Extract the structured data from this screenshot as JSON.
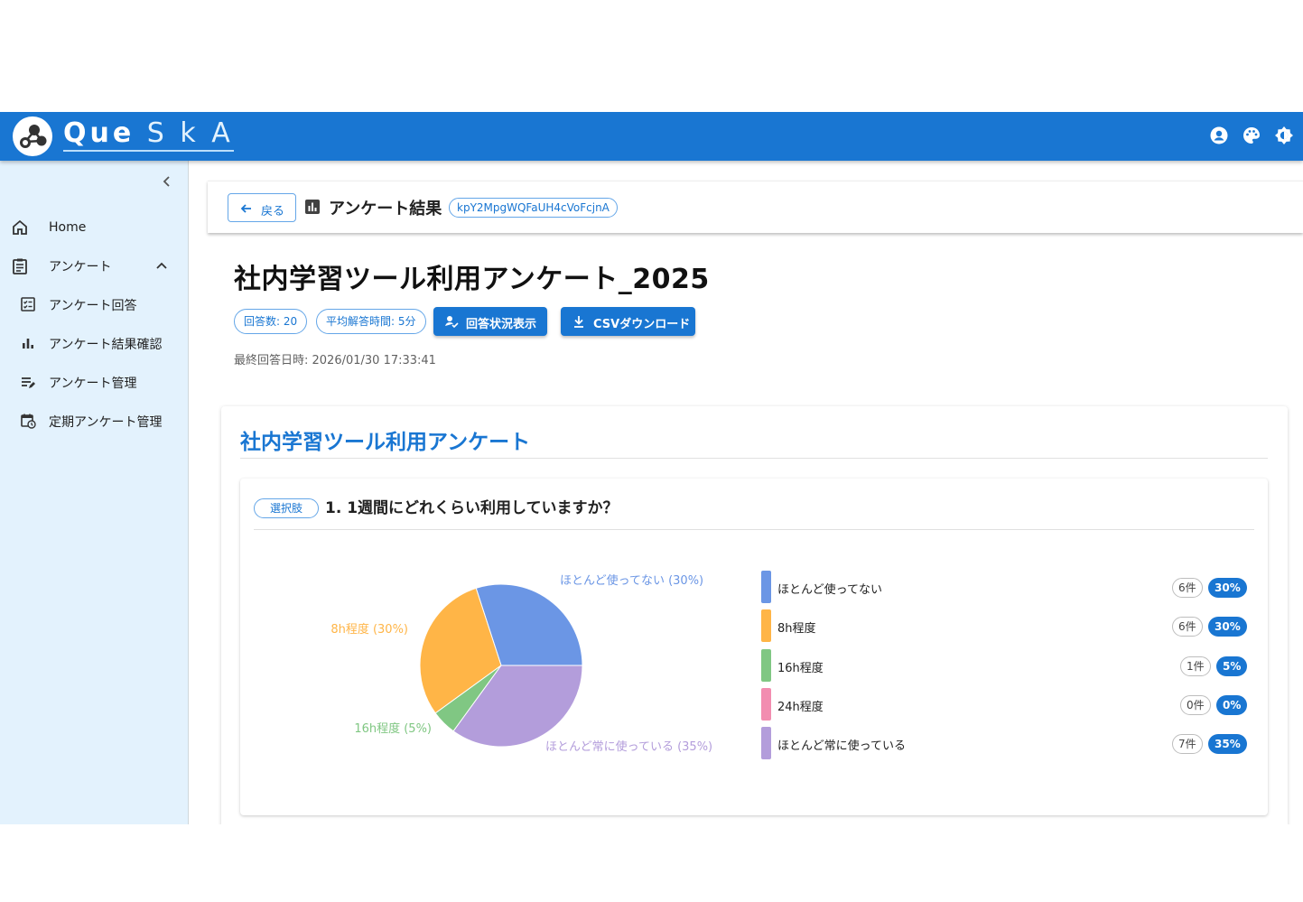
{
  "header": {
    "logo_text_que": "Que",
    "logo_text_ska": "S k A"
  },
  "sidebar": {
    "items": [
      {
        "label": "Home",
        "icon": "home-icon"
      },
      {
        "label": "アンケート",
        "icon": "clipboard-icon"
      },
      {
        "label": "アンケート回答",
        "icon": "checklist-icon"
      },
      {
        "label": "アンケート結果確認",
        "icon": "bar-chart-icon"
      },
      {
        "label": "アンケート管理",
        "icon": "edit-list-icon"
      },
      {
        "label": "定期アンケート管理",
        "icon": "calendar-clock-icon"
      }
    ]
  },
  "topbar": {
    "back_label": "戻る",
    "result_title": "アンケート結果",
    "survey_id": "kpY2MpgWQFaUH4cVoFcjnA"
  },
  "page": {
    "title": "社内学習ツール利用アンケート_2025",
    "response_count": "回答数: 20",
    "avg_time": "平均解答時間: 5分",
    "status_button": "回答状況表示",
    "csv_button": "CSVダウンロード",
    "last_answer": "最終回答日時: 2026/01/30 17:33:41"
  },
  "survey": {
    "title": "社内学習ツール利用アンケート",
    "question": {
      "type_chip": "選択肢",
      "text": "1. 1週間にどれくらい利用していますか？",
      "options": [
        {
          "label": "ほとんど使ってない",
          "count": "6件",
          "pct": "30%",
          "color": "#6b96e5"
        },
        {
          "label": "8h程度",
          "count": "6件",
          "pct": "30%",
          "color": "#ffb547"
        },
        {
          "label": "16h程度",
          "count": "1件",
          "pct": "5%",
          "color": "#80c783"
        },
        {
          "label": "24h程度",
          "count": "0件",
          "pct": "0%",
          "color": "#f28db0"
        },
        {
          "label": "ほとんど常に使っている",
          "count": "7件",
          "pct": "35%",
          "color": "#b39ddb"
        }
      ],
      "pie_labels": [
        "ほとんど使ってない (30%)",
        "8h程度 (30%)",
        "16h程度 (5%)",
        "ほとんど常に使っている (35%)"
      ]
    }
  },
  "chart_data": {
    "type": "pie",
    "categories": [
      "ほとんど使ってない",
      "8h程度",
      "16h程度",
      "24h程度",
      "ほとんど常に使っている"
    ],
    "values": [
      30,
      30,
      5,
      0,
      35
    ],
    "counts": [
      6,
      6,
      1,
      0,
      7
    ],
    "colors": [
      "#6b96e5",
      "#ffb547",
      "#80c783",
      "#f28db0",
      "#b39ddb"
    ]
  }
}
